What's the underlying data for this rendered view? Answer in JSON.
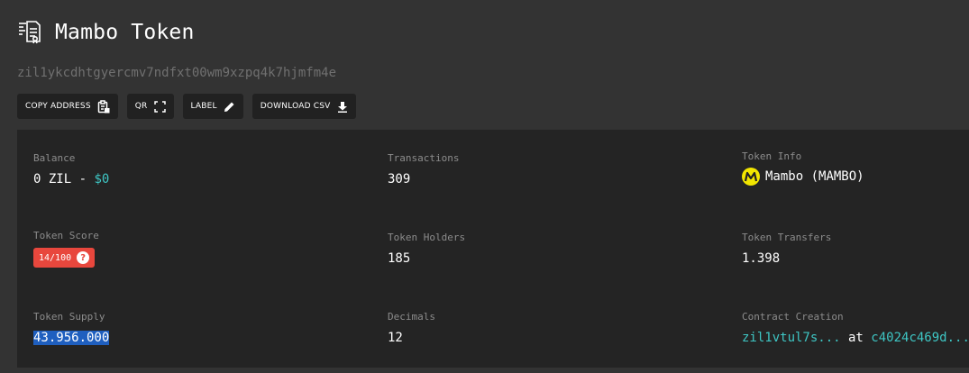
{
  "page": {
    "title": "Mambo Token",
    "address": "zil1ykcdhtgyercmv7ndfxt00wm9xzpq4k7hjmfm4e",
    "title_icon": "document-list-icon"
  },
  "buttons": [
    {
      "label": "COPY ADDRESS",
      "icon": "clipboard-icon"
    },
    {
      "label": "QR",
      "icon": "fullscreen-icon"
    },
    {
      "label": "LABEL",
      "icon": "pencil-icon"
    },
    {
      "label": "DOWNLOAD CSV",
      "icon": "download-icon"
    }
  ],
  "stats": {
    "balance": {
      "label": "Balance",
      "zil": "0 ZIL",
      "separator": " - ",
      "usd": "$0"
    },
    "transactions": {
      "label": "Transactions",
      "value": "309"
    },
    "token_info": {
      "label": "Token Info",
      "name": "Mambo",
      "symbol": "(MAMBO)",
      "logo_color": "#f2e600"
    },
    "token_score": {
      "label": "Token Score",
      "value": "14/100",
      "badge_color": "#e8473d"
    },
    "token_holders": {
      "label": "Token Holders",
      "value": "185"
    },
    "token_transfers": {
      "label": "Token Transfers",
      "value": "1.398"
    },
    "token_supply": {
      "label": "Token Supply",
      "value": "43.956.000"
    },
    "decimals": {
      "label": "Decimals",
      "value": "12"
    },
    "contract_creation": {
      "label": "Contract Creation",
      "creator": "zil1vtul7s...",
      "at": " at ",
      "tx": "c4024c469d..."
    }
  },
  "colors": {
    "background": "#333333",
    "panel": "#242424",
    "button": "#212121",
    "link": "#3ec6c4",
    "muted": "#707070"
  }
}
